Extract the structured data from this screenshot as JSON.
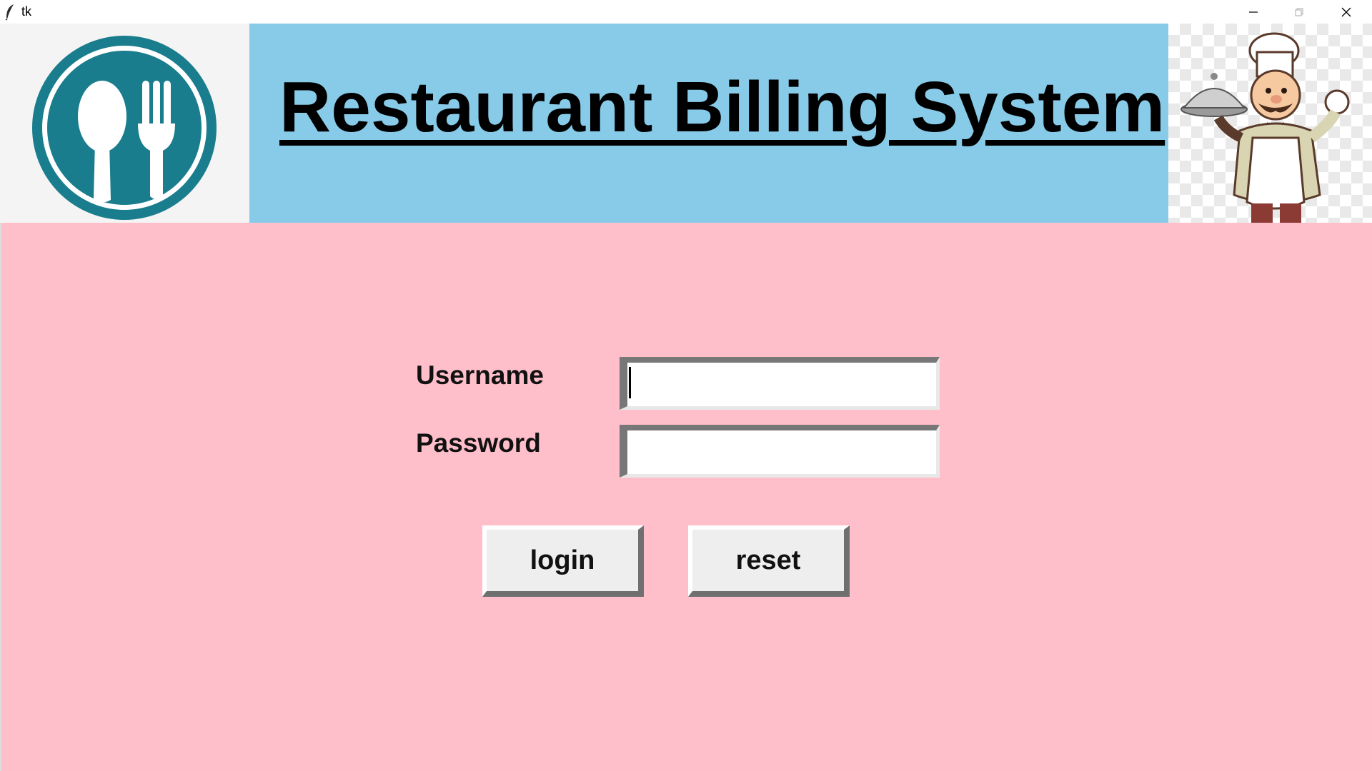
{
  "window": {
    "title": "tk",
    "icons": {
      "app": "feather-icon",
      "minimize": "minimize-icon",
      "maximize": "maximize-icon",
      "close": "close-icon"
    }
  },
  "header": {
    "title": "Restaurant Billing System",
    "logo": "spoon-fork-icon",
    "mascot": "chef-icon"
  },
  "login": {
    "username_label": "Username",
    "password_label": "Password",
    "username_value": "",
    "password_value": "",
    "login_button": "login",
    "reset_button": "reset"
  },
  "colors": {
    "banner": "#87cbe9",
    "background": "#ffbfca",
    "logo": "#1a7d8d"
  }
}
